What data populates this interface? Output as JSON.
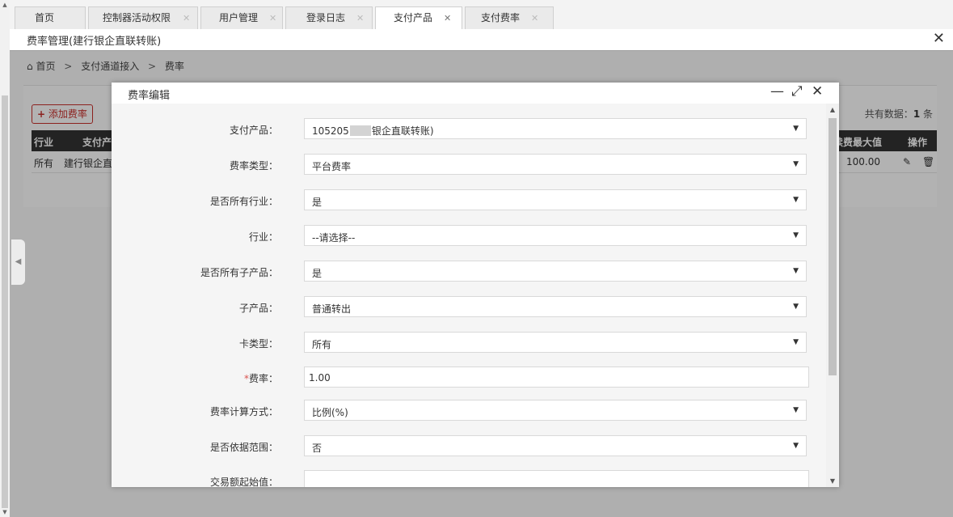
{
  "tabs": [
    {
      "label": "首页",
      "closable": false
    },
    {
      "label": "控制器活动权限",
      "closable": true
    },
    {
      "label": "用户管理",
      "closable": true
    },
    {
      "label": "登录日志",
      "closable": true
    },
    {
      "label": "支付产品",
      "closable": true,
      "active": true
    },
    {
      "label": "支付费率",
      "closable": true
    }
  ],
  "page": {
    "title": "费率管理(建行银企直联转账)",
    "close_glyph": "✕"
  },
  "breadcrumb": {
    "home_icon": "home-icon",
    "items": [
      "首页",
      "支付通道接入",
      "费率"
    ],
    "separator": ">"
  },
  "toolbar": {
    "add_icon": "+",
    "add_label": "添加费率",
    "total_prefix": "共有数据：",
    "total_count": "1",
    "total_suffix": " 条"
  },
  "table": {
    "headers": [
      "行业",
      "支付产",
      "续费最大值",
      "操作"
    ],
    "rows": [
      {
        "industry": "所有",
        "product": "建行银企直",
        "max_fee": "100.00"
      }
    ]
  },
  "modal": {
    "title": "费率编辑",
    "minimize_glyph": "—",
    "maximize_glyph": "⤢",
    "close_glyph": "✕",
    "fields": [
      {
        "label": "支付产品：",
        "value_prefix": "105205",
        "value_suffix": "银企直联转账)",
        "type": "select",
        "masked": true
      },
      {
        "label": "费率类型：",
        "value": "平台费率",
        "type": "select"
      },
      {
        "label": "是否所有行业：",
        "value": "是",
        "type": "select"
      },
      {
        "label": "行业：",
        "value": "--请选择--",
        "type": "select"
      },
      {
        "label": "是否所有子产品：",
        "value": "是",
        "type": "select"
      },
      {
        "label": "子产品：",
        "value": "普通转出",
        "type": "select"
      },
      {
        "label": "卡类型：",
        "value": "所有",
        "type": "select"
      },
      {
        "label": "费率：",
        "value": "1.00",
        "type": "input",
        "required": true
      },
      {
        "label": "费率计算方式：",
        "value": "比例(%)",
        "type": "select"
      },
      {
        "label": "是否依据范围：",
        "value": "否",
        "type": "select"
      },
      {
        "label": "交易额起始值：",
        "value": "",
        "type": "input"
      }
    ]
  },
  "colors": {
    "accent_red": "#c9302c",
    "table_header_bg": "#333333",
    "required_star": "#d9534f"
  }
}
